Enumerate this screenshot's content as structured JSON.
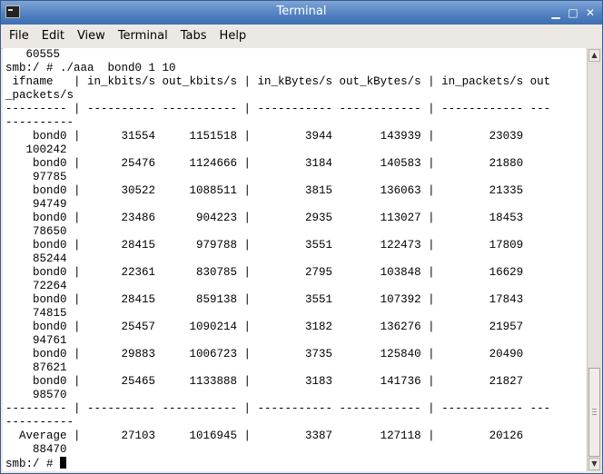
{
  "window": {
    "title": "Terminal",
    "controls": {
      "minimize": "▁",
      "maximize": "□",
      "close": "✕"
    }
  },
  "menu": {
    "items": [
      "File",
      "Edit",
      "View",
      "Terminal",
      "Tabs",
      "Help"
    ]
  },
  "terminal": {
    "lines": [
      "   60555",
      "smb:/ # ./aaa  bond0 1 10",
      " ifname   | in_kbits/s out_kbits/s | in_kBytes/s out_kBytes/s | in_packets/s out",
      "_packets/s",
      "--------- | ---------- ----------- | ----------- ------------ | ------------ ---",
      "----------",
      "    bond0 |      31554     1151518 |        3944       143939 |        23039",
      "   100242",
      "    bond0 |      25476     1124666 |        3184       140583 |        21880",
      "    97785",
      "    bond0 |      30522     1088511 |        3815       136063 |        21335",
      "    94749",
      "    bond0 |      23486      904223 |        2935       113027 |        18453",
      "    78650",
      "    bond0 |      28415      979788 |        3551       122473 |        17809",
      "    85244",
      "    bond0 |      22361      830785 |        2795       103848 |        16629",
      "    72264",
      "    bond0 |      28415      859138 |        3551       107392 |        17843",
      "    74815",
      "    bond0 |      25457     1090214 |        3182       136276 |        21957",
      "    94761",
      "    bond0 |      29883     1006723 |        3735       125840 |        20490",
      "    87621",
      "    bond0 |      25465     1133888 |        3183       141736 |        21827",
      "    98570",
      "--------- | ---------- ----------- | ----------- ------------ | ------------ ---",
      "----------",
      "  Average |      27103     1016945 |        3387       127118 |        20126",
      "    88470"
    ],
    "prompt": "smb:/ # "
  }
}
